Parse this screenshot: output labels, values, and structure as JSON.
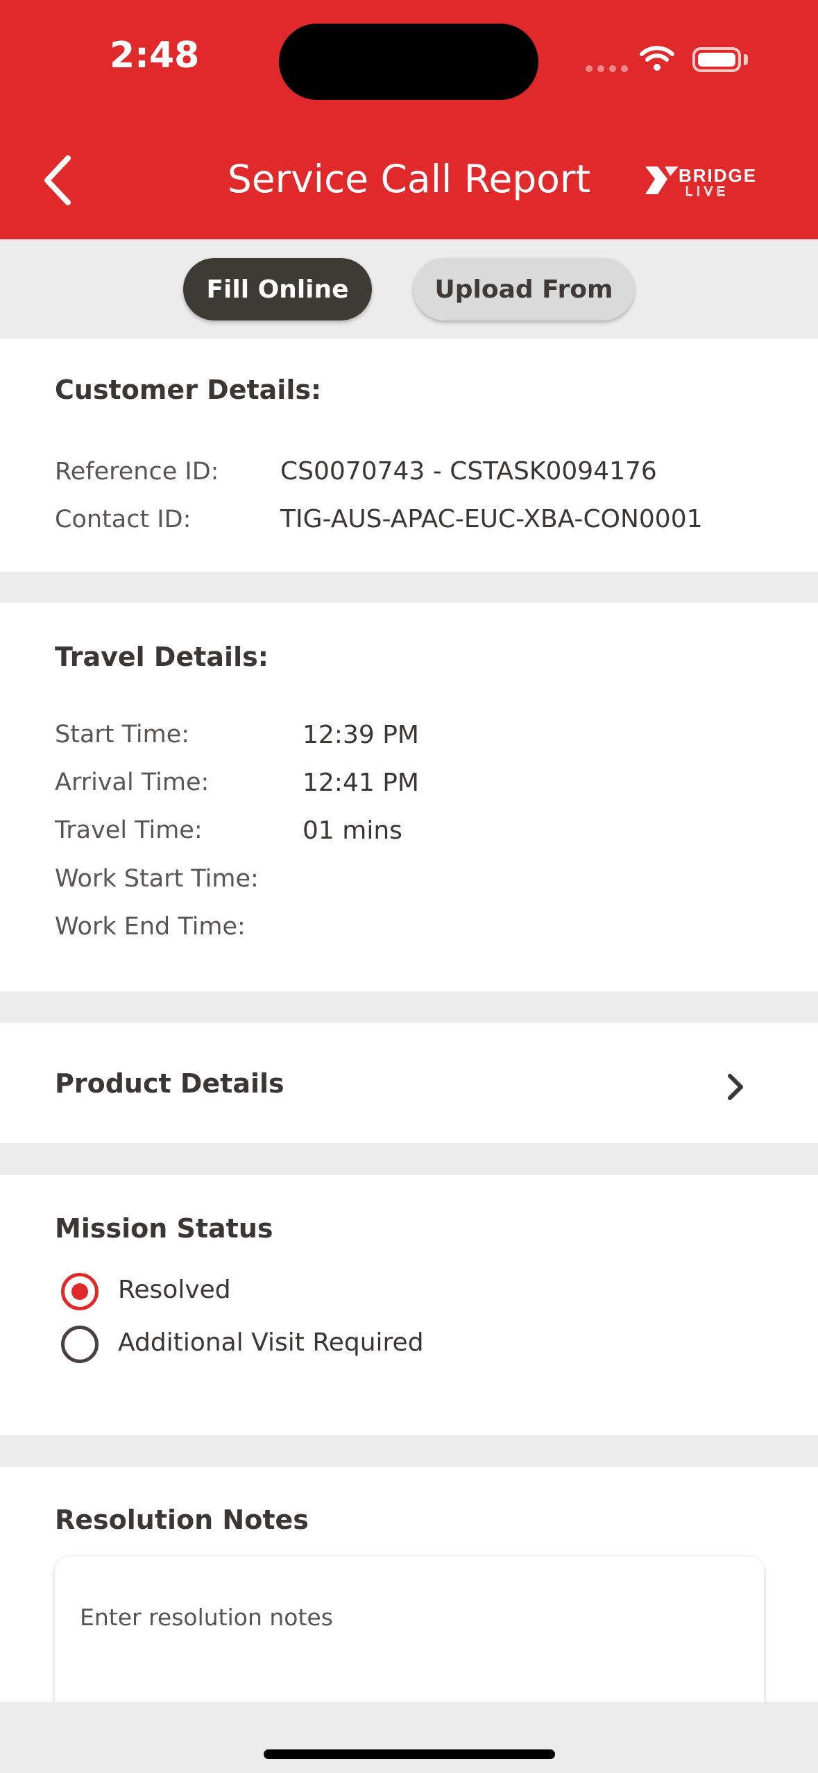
{
  "status_bar": {
    "time": "2:48"
  },
  "header": {
    "title": "Service Call Report",
    "logo_top": "BRIDGE",
    "logo_bottom": "LIVE"
  },
  "toggle": {
    "fill_online": "Fill Online",
    "upload_from": "Upload From"
  },
  "customer": {
    "title": "Customer Details:",
    "reference_label": "Reference ID:",
    "reference_value": "CS0070743 - CSTASK0094176",
    "contact_label": "Contact ID:",
    "contact_value": "TIG-AUS-APAC-EUC-XBA-CON0001"
  },
  "travel": {
    "title": "Travel Details:",
    "rows": [
      {
        "label": "Start Time:",
        "value": "12:39 PM"
      },
      {
        "label": "Arrival Time:",
        "value": "12:41 PM"
      },
      {
        "label": "Travel Time:",
        "value": "01 mins"
      },
      {
        "label": "Work Start Time:",
        "value": ""
      },
      {
        "label": "Work End Time:",
        "value": ""
      }
    ]
  },
  "product": {
    "title": "Product Details"
  },
  "mission": {
    "title": "Mission Status",
    "options": [
      {
        "label": "Resolved",
        "selected": true
      },
      {
        "label": "Additional Visit Required",
        "selected": false
      }
    ]
  },
  "notes": {
    "title": "Resolution Notes",
    "placeholder": "Enter resolution notes"
  },
  "colors": {
    "accent": "#e0292a",
    "dark_pill": "#3d3b35",
    "background": "#ececec"
  }
}
